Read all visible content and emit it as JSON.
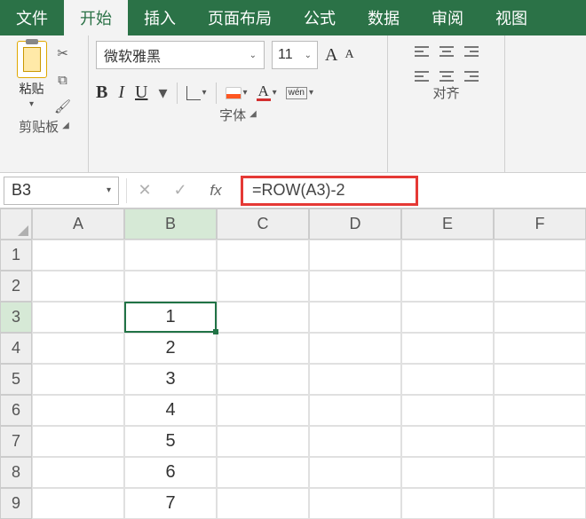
{
  "tabs": {
    "file": "文件",
    "home": "开始",
    "insert": "插入",
    "pageLayout": "页面布局",
    "formulas": "公式",
    "data": "数据",
    "review": "审阅",
    "view": "视图"
  },
  "ribbon": {
    "clipboard": {
      "label": "剪贴板",
      "pasteLabel": "粘贴"
    },
    "font": {
      "label": "字体",
      "fontName": "微软雅黑",
      "fontSize": "11",
      "bigA": "A",
      "smallA": "A",
      "bold": "B",
      "italic": "I",
      "underline": "U",
      "fontColor": "A",
      "wen": "wén"
    },
    "align": {
      "label": "对齐"
    }
  },
  "formulaBar": {
    "nameBox": "B3",
    "cancel": "✕",
    "confirm": "✓",
    "fx": "fx",
    "formula": "=ROW(A3)-2"
  },
  "columns": [
    "A",
    "B",
    "C",
    "D",
    "E",
    "F"
  ],
  "rows": [
    "1",
    "2",
    "3",
    "4",
    "5",
    "6",
    "7",
    "8",
    "9"
  ],
  "selected": {
    "row": 2,
    "col": 1
  },
  "cells": {
    "B3": "1",
    "B4": "2",
    "B5": "3",
    "B6": "4",
    "B7": "5",
    "B8": "6",
    "B9": "7"
  }
}
